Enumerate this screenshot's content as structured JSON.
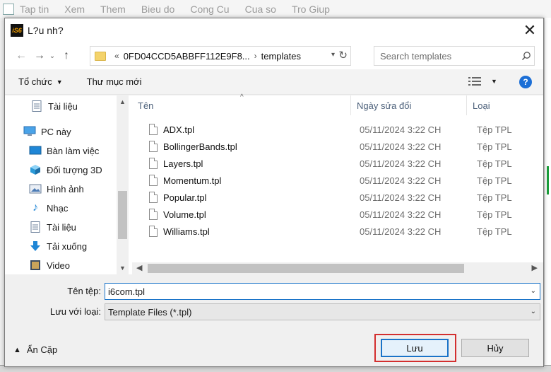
{
  "app": {
    "menu": [
      "Tap tin",
      "Xem",
      "Them",
      "Bieu do",
      "Cong Cu",
      "Cua so",
      "Tro Giup"
    ]
  },
  "dialog": {
    "title": "L?u nh?",
    "logo_text": "iS6",
    "close_glyph": "✕"
  },
  "nav": {
    "back_glyph": "←",
    "forward_glyph": "→",
    "recent_glyph": "⌄",
    "up_glyph": "↑",
    "address": {
      "overflow": "«",
      "path": [
        "0FD04CCD5ABBFF112E9F8...",
        "templates"
      ],
      "separator": "›"
    },
    "search_placeholder": "Search templates"
  },
  "toolbar": {
    "organize_label": "Tổ chức",
    "new_folder_label": "Thư mục mới"
  },
  "sidebar": {
    "items": [
      {
        "label": "Tài liệu",
        "icon": "document-icon",
        "indent": 1
      },
      {
        "label": "PC này",
        "icon": "computer-icon",
        "indent": 0
      },
      {
        "label": "Bàn làm việc",
        "icon": "desktop-icon",
        "indent": 1
      },
      {
        "label": "Đối tượng 3D",
        "icon": "cube-3d-icon",
        "indent": 1
      },
      {
        "label": "Hình ảnh",
        "icon": "pictures-icon",
        "indent": 1
      },
      {
        "label": "Nhạc",
        "icon": "music-icon",
        "indent": 1
      },
      {
        "label": "Tài liệu",
        "icon": "document-icon",
        "indent": 1
      },
      {
        "label": "Tải xuống",
        "icon": "download-icon",
        "indent": 1
      },
      {
        "label": "Video",
        "icon": "video-icon",
        "indent": 1
      }
    ]
  },
  "files": {
    "columns": {
      "name": "Tên",
      "date": "Ngày sửa đổi",
      "type": "Loại"
    },
    "rows": [
      {
        "name": "ADX.tpl",
        "date": "05/11/2024 3:22 CH",
        "type": "Tệp TPL"
      },
      {
        "name": "BollingerBands.tpl",
        "date": "05/11/2024 3:22 CH",
        "type": "Tệp TPL"
      },
      {
        "name": "Layers.tpl",
        "date": "05/11/2024 3:22 CH",
        "type": "Tệp TPL"
      },
      {
        "name": "Momentum.tpl",
        "date": "05/11/2024 3:22 CH",
        "type": "Tệp TPL"
      },
      {
        "name": "Popular.tpl",
        "date": "05/11/2024 3:22 CH",
        "type": "Tệp TPL"
      },
      {
        "name": "Volume.tpl",
        "date": "05/11/2024 3:22 CH",
        "type": "Tệp TPL"
      },
      {
        "name": "Williams.tpl",
        "date": "05/11/2024 3:22 CH",
        "type": "Tệp TPL"
      }
    ]
  },
  "form": {
    "filename_label": "Tên tệp:",
    "filename_value": "i6com.tpl",
    "filetype_label": "Lưu với loại:",
    "filetype_value": "Template Files (*.tpl)"
  },
  "footer": {
    "hide_folders_label": "Ẩn Cặp",
    "save_label": "Lưu",
    "cancel_label": "Hủy"
  },
  "colors": {
    "accent": "#1a73c8",
    "highlight": "#d32f2f",
    "help": "#1c6fd6"
  }
}
